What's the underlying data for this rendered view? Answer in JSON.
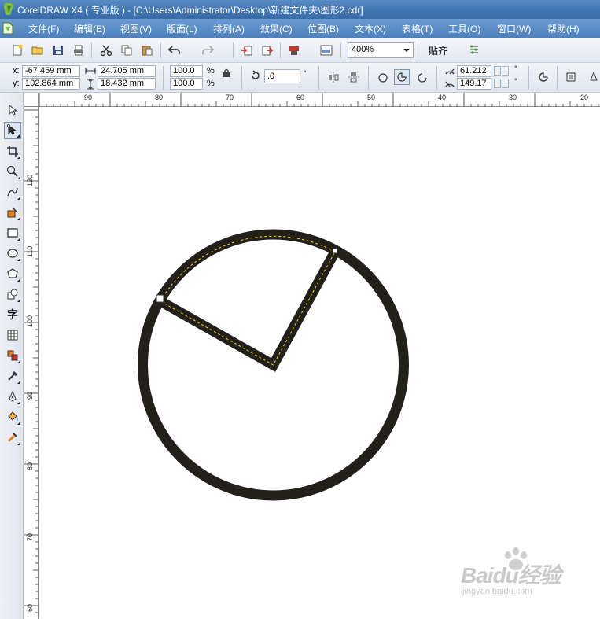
{
  "window": {
    "title": "CorelDRAW X4 ( 专业版 ) - [C:\\Users\\Administrator\\Desktop\\新建文件夹\\图形2.cdr]"
  },
  "menu": [
    {
      "label": "文件(F)"
    },
    {
      "label": "编辑(E)"
    },
    {
      "label": "视图(V)"
    },
    {
      "label": "版面(L)"
    },
    {
      "label": "排列(A)"
    },
    {
      "label": "效果(C)"
    },
    {
      "label": "位图(B)"
    },
    {
      "label": "文本(X)"
    },
    {
      "label": "表格(T)"
    },
    {
      "label": "工具(O)"
    },
    {
      "label": "窗口(W)"
    },
    {
      "label": "帮助(H)"
    }
  ],
  "toolbar": {
    "zoom": "400%",
    "snap_label": "贴齐"
  },
  "property_bar": {
    "x_label": "x:",
    "x_value": "-67.459 mm",
    "y_label": "y:",
    "y_value": "102.864 mm",
    "width_value": "24.705 mm",
    "height_value": "18.432 mm",
    "scale_x": "100.0",
    "scale_y": "100.0",
    "percent": "%",
    "rotation": ".0",
    "degree": "°",
    "start_angle": "61.212",
    "end_angle": "149.17"
  },
  "rulers": {
    "horizontal": [
      "90",
      "80",
      "70",
      "60",
      "50",
      "40",
      "30",
      "20"
    ],
    "vertical": [
      "120",
      "110",
      "100",
      "90",
      "80",
      "70",
      "60"
    ]
  },
  "toolbox": {
    "text_tool_glyph": "字"
  },
  "watermark": {
    "brand": "Baidu经验",
    "url": "jingyan.baidu.com"
  },
  "colors": {
    "title_bar": "#3f74b3",
    "menu_bar": "#4d80bd",
    "shape_outline": "#231f1a",
    "selection_dash": "#f2e300"
  }
}
